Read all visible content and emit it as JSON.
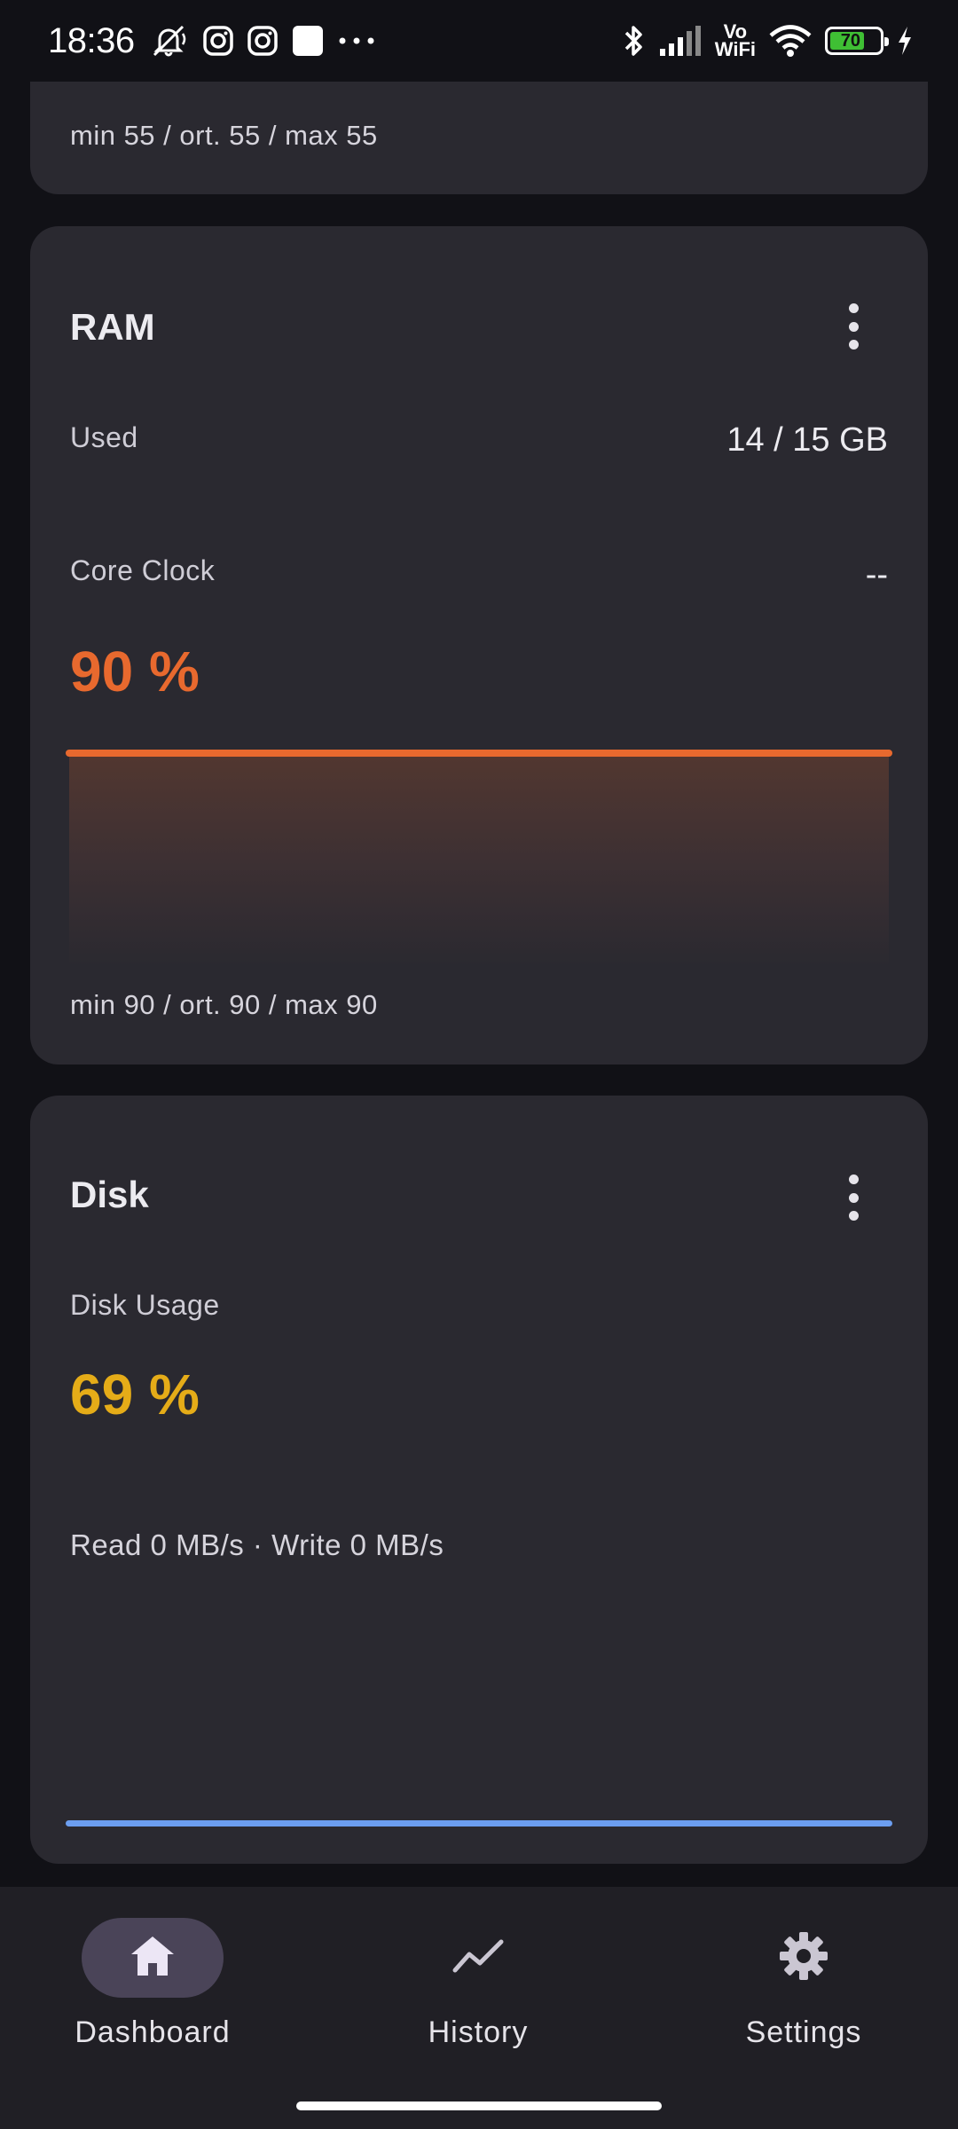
{
  "status_bar": {
    "time": "18:36",
    "vowifi_top": "Vo",
    "vowifi_bottom": "WiFi",
    "battery_level": "70"
  },
  "top_card": {
    "stats": "min 55 / ort. 55 / max 55"
  },
  "ram_card": {
    "title": "RAM",
    "used_label": "Used",
    "used_value": "14 / 15 GB",
    "core_clock_label": "Core Clock",
    "core_clock_value": "--",
    "percent": "90 %",
    "stats": "min 90 / ort. 90 / max 90",
    "accent_color": "#e8692e"
  },
  "disk_card": {
    "title": "Disk",
    "usage_label": "Disk Usage",
    "percent": "69 %",
    "io_text": "Read 0 MB/s · Write 0 MB/s",
    "accent_color": "#e5ac18",
    "line_color": "#6c9ef0"
  },
  "bottom_nav": {
    "items": [
      {
        "label": "Dashboard",
        "icon": "home-icon",
        "active": true
      },
      {
        "label": "History",
        "icon": "trend-icon",
        "active": false
      },
      {
        "label": "Settings",
        "icon": "gear-icon",
        "active": false
      }
    ]
  }
}
